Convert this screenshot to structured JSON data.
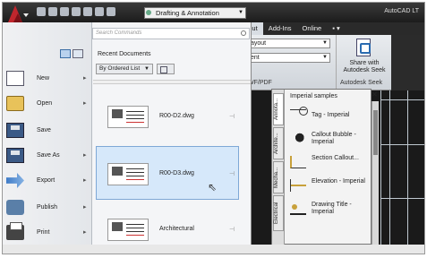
{
  "titlebar": {
    "workspace": "Drafting & Annotation",
    "app_title": "AutoCAD LT"
  },
  "ribbon": {
    "tabs": [
      "utput",
      "Add-Ins",
      "Online"
    ],
    "combo1": "ayout",
    "combo2": "ent",
    "panel_label": "WF/PDF",
    "seek_label": "Share with Autodesk Seek",
    "seek_panel": "Autodesk Seek"
  },
  "appmenu": {
    "search_placeholder": "Search Commands",
    "recent_title": "Recent Documents",
    "order_label": "By Ordered List",
    "items": [
      {
        "label": "New"
      },
      {
        "label": "Open"
      },
      {
        "label": "Save"
      },
      {
        "label": "Save As"
      },
      {
        "label": "Export"
      },
      {
        "label": "Publish"
      },
      {
        "label": "Print"
      }
    ],
    "documents": [
      {
        "name": "R00-D2.dwg"
      },
      {
        "name": "R00-D3.dwg"
      },
      {
        "name": "Architectural"
      }
    ]
  },
  "palette": {
    "title": "Imperial samples",
    "tabs": [
      "Annota...",
      "Archite...",
      "Mecha...",
      "Electrical"
    ],
    "items": [
      {
        "label": "Tag - Imperial"
      },
      {
        "label": "Callout Bubble - Imperial"
      },
      {
        "label": "Section Callout..."
      },
      {
        "label": "Elevation - Imperial"
      },
      {
        "label": "Drawing Title - Imperial"
      }
    ]
  },
  "colors": {
    "titlebar": "#1c1c1c",
    "selection": "#d6e8fa",
    "app_button": "#c0262d"
  }
}
